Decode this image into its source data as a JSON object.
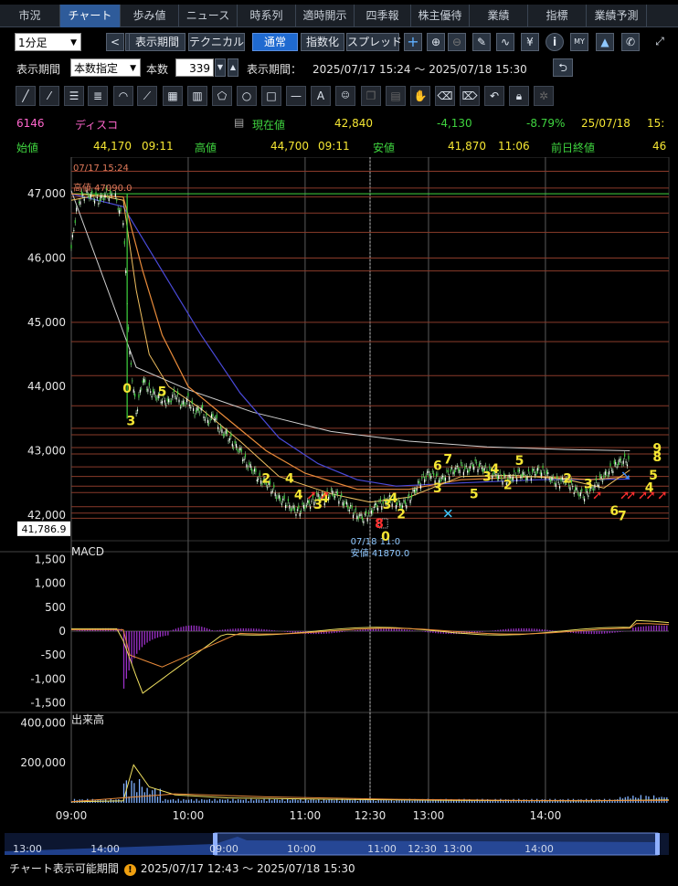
{
  "tabs": [
    "市況",
    "チャート",
    "歩み値",
    "ニュース",
    "時系列",
    "適時開示",
    "四季報",
    "株主優待",
    "業績",
    "指標",
    "業績予測"
  ],
  "active_tab": "チャート",
  "toolbar": {
    "interval": "1分足",
    "prev": "<",
    "next": ">",
    "period_btn": "表示期間",
    "technical_btn": "テクニカル",
    "normal_btn": "通常",
    "index_btn": "指数化",
    "spread_btn": "スプレッド",
    "plus": "+",
    "zoom_in": "⊕",
    "zoom_out": "⊖",
    "draw": "✎",
    "wave": "∿",
    "yen": "¥",
    "info": "i",
    "my": "MY",
    "mountain": "▲",
    "wrench": "✆",
    "expand": "⤢"
  },
  "period": {
    "label": "表示期間",
    "mode": "本数指定",
    "count_label": "本数",
    "count": "339",
    "range_label": "表示期間：",
    "range": "2025/07/17 15:24 ～ 2025/07/18 15:30",
    "reset": "⮌"
  },
  "quote": {
    "code": "6146",
    "name": "ディスコ",
    "current_label": "現在値",
    "current": "42,840",
    "change": "-4,130",
    "change_pct": "-8.79%",
    "date": "25/07/18",
    "time_cut": "15:",
    "open_label": "始値",
    "open": "44,170",
    "open_time": "09:11",
    "high_label": "高値",
    "high": "44,700",
    "high_time": "09:11",
    "low_label": "安値",
    "low": "41,870",
    "low_time": "11:06",
    "prev_label": "前日終値",
    "prev": "46"
  },
  "colors": {
    "bg": "#000000",
    "green": "#3fd43f",
    "yellow": "#f5e633",
    "red": "#ff3030",
    "pink": "#ff66cc",
    "hline": "#8a3b2a",
    "grid": "#5a5a5a"
  },
  "chart_data": {
    "type": "line",
    "price": {
      "yticks": [
        "47,000",
        "46,000",
        "45,000",
        "44,000",
        "43,000",
        "42,000"
      ],
      "ylim": [
        41600,
        47500
      ],
      "last_label": "41,786.9",
      "high_note_date": "07/17 15:24",
      "high_note_text": "高値 47090.0",
      "low_note_date": "07/18 11:0",
      "low_note_text": "安値 41870.0",
      "close": [
        [
          0,
          46150
        ],
        [
          6,
          46900
        ],
        [
          12,
          47000
        ],
        [
          17,
          46950
        ],
        [
          22,
          46900
        ],
        [
          27,
          47000
        ],
        [
          34,
          46950
        ],
        [
          40,
          46600
        ],
        [
          45,
          44500
        ],
        [
          50,
          43600
        ],
        [
          55,
          44100
        ],
        [
          60,
          43950
        ],
        [
          65,
          43850
        ],
        [
          70,
          43800
        ],
        [
          75,
          43750
        ],
        [
          80,
          43900
        ],
        [
          85,
          43700
        ],
        [
          90,
          43800
        ],
        [
          95,
          43600
        ],
        [
          100,
          43650
        ],
        [
          105,
          43450
        ],
        [
          110,
          43550
        ],
        [
          115,
          43300
        ],
        [
          120,
          43250
        ],
        [
          125,
          43100
        ],
        [
          130,
          43000
        ],
        [
          135,
          42800
        ],
        [
          140,
          42700
        ],
        [
          145,
          42550
        ],
        [
          150,
          42500
        ],
        [
          155,
          42400
        ],
        [
          160,
          42250
        ],
        [
          165,
          42200
        ],
        [
          170,
          42100
        ],
        [
          175,
          42050
        ],
        [
          180,
          42150
        ],
        [
          185,
          42200
        ],
        [
          190,
          42300
        ],
        [
          195,
          42250
        ],
        [
          200,
          42350
        ],
        [
          205,
          42300
        ],
        [
          210,
          42200
        ],
        [
          215,
          42100
        ],
        [
          220,
          42000
        ],
        [
          225,
          41950
        ],
        [
          230,
          42050
        ],
        [
          235,
          42150
        ],
        [
          240,
          42200
        ],
        [
          245,
          42250
        ],
        [
          250,
          42200
        ],
        [
          255,
          42150
        ],
        [
          260,
          42250
        ],
        [
          265,
          42400
        ],
        [
          270,
          42550
        ],
        [
          275,
          42650
        ],
        [
          280,
          42600
        ],
        [
          285,
          42550
        ],
        [
          290,
          42650
        ],
        [
          295,
          42700
        ],
        [
          300,
          42750
        ],
        [
          305,
          42700
        ],
        [
          310,
          42800
        ],
        [
          315,
          42750
        ],
        [
          320,
          42700
        ],
        [
          325,
          42650
        ],
        [
          330,
          42600
        ],
        [
          335,
          42550
        ],
        [
          340,
          42600
        ],
        [
          345,
          42650
        ],
        [
          350,
          42600
        ],
        [
          355,
          42650
        ],
        [
          360,
          42700
        ],
        [
          365,
          42650
        ],
        [
          370,
          42550
        ],
        [
          375,
          42500
        ],
        [
          380,
          42550
        ],
        [
          385,
          42450
        ],
        [
          390,
          42350
        ],
        [
          395,
          42300
        ],
        [
          400,
          42400
        ],
        [
          405,
          42500
        ],
        [
          410,
          42600
        ],
        [
          415,
          42700
        ],
        [
          420,
          42800
        ],
        [
          425,
          42850
        ],
        [
          430,
          42840
        ]
      ],
      "ma_short": [
        [
          0,
          46900
        ],
        [
          20,
          46980
        ],
        [
          40,
          46900
        ],
        [
          50,
          45500
        ],
        [
          60,
          44500
        ],
        [
          75,
          44000
        ],
        [
          100,
          43650
        ],
        [
          130,
          43150
        ],
        [
          160,
          42600
        ],
        [
          200,
          42330
        ],
        [
          230,
          42200
        ],
        [
          260,
          42280
        ],
        [
          300,
          42600
        ],
        [
          340,
          42620
        ],
        [
          380,
          42560
        ],
        [
          410,
          42420
        ],
        [
          430,
          42700
        ]
      ],
      "ma_mid": [
        [
          0,
          47000
        ],
        [
          40,
          46950
        ],
        [
          55,
          45800
        ],
        [
          70,
          44800
        ],
        [
          90,
          44000
        ],
        [
          120,
          43500
        ],
        [
          150,
          43000
        ],
        [
          180,
          42650
        ],
        [
          220,
          42400
        ],
        [
          260,
          42400
        ],
        [
          300,
          42550
        ],
        [
          360,
          42600
        ],
        [
          400,
          42550
        ],
        [
          430,
          42600
        ]
      ],
      "ma_long": [
        [
          0,
          47000
        ],
        [
          40,
          46800
        ],
        [
          70,
          45800
        ],
        [
          100,
          44800
        ],
        [
          130,
          43900
        ],
        [
          160,
          43200
        ],
        [
          190,
          42800
        ],
        [
          220,
          42550
        ],
        [
          250,
          42450
        ],
        [
          300,
          42500
        ],
        [
          360,
          42550
        ],
        [
          430,
          42560
        ]
      ],
      "ma_vlong": [
        [
          0,
          47050
        ],
        [
          50,
          44300
        ],
        [
          90,
          43950
        ],
        [
          140,
          43600
        ],
        [
          200,
          43300
        ],
        [
          260,
          43150
        ],
        [
          320,
          43060
        ],
        [
          380,
          43020
        ],
        [
          430,
          43000
        ]
      ],
      "hlines": [
        47350,
        47090,
        46950,
        46700,
        46400,
        46000,
        45800,
        45000,
        44700,
        44170,
        43700,
        43350,
        43250,
        43050,
        42950,
        42750,
        42600,
        42450,
        42350,
        42130,
        42030,
        41950
      ],
      "signals": [
        {
          "t": "0",
          "i": 43,
          "p": 43900
        },
        {
          "t": "3",
          "i": 46,
          "p": 43400
        },
        {
          "t": "5",
          "i": 70,
          "p": 43850
        },
        {
          "t": "2",
          "i": 150,
          "p": 42500
        },
        {
          "t": "4",
          "i": 168,
          "p": 42500
        },
        {
          "t": "4",
          "i": 175,
          "p": 42250
        },
        {
          "t": "3",
          "i": 190,
          "p": 42100
        },
        {
          "t": "4",
          "i": 195,
          "p": 42200
        },
        {
          "t": "3",
          "i": 243,
          "p": 42100
        },
        {
          "t": "4",
          "i": 248,
          "p": 42200
        },
        {
          "t": "2",
          "i": 254,
          "p": 41950
        },
        {
          "t": "8",
          "i": 237,
          "p": 41800
        },
        {
          "t": "0",
          "i": 242,
          "p": 41600
        },
        {
          "t": "6",
          "i": 282,
          "p": 42700
        },
        {
          "t": "7",
          "i": 290,
          "p": 42800
        },
        {
          "t": "3",
          "i": 282,
          "p": 42350
        },
        {
          "t": "5",
          "i": 310,
          "p": 42260
        },
        {
          "t": "3",
          "i": 320,
          "p": 42530
        },
        {
          "t": "4",
          "i": 326,
          "p": 42650
        },
        {
          "t": "2",
          "i": 336,
          "p": 42400
        },
        {
          "t": "5",
          "i": 345,
          "p": 42780
        },
        {
          "t": "2",
          "i": 382,
          "p": 42500
        },
        {
          "t": "3",
          "i": 398,
          "p": 42420
        },
        {
          "t": "6",
          "i": 418,
          "p": 42000
        },
        {
          "t": "7",
          "i": 424,
          "p": 41920
        },
        {
          "t": "4",
          "i": 445,
          "p": 42360
        },
        {
          "t": "5",
          "i": 448,
          "p": 42550
        },
        {
          "t": "8",
          "i": 451,
          "p": 42840
        },
        {
          "t": "9",
          "i": 451,
          "p": 42970
        }
      ],
      "arrows_red": [
        185,
        195,
        405,
        426,
        431,
        440,
        446,
        455
      ],
      "arrows_blue": [
        448
      ],
      "cross": [
        290
      ],
      "xticks": [
        {
          "label": "09:00",
          "i": 0
        },
        {
          "label": "10:00",
          "i": 90
        },
        {
          "label": "11:00",
          "i": 180
        },
        {
          "label": "12:30",
          "i": 230
        },
        {
          "label": "13:00",
          "i": 275
        },
        {
          "label": "14:00",
          "i": 365
        }
      ]
    },
    "macd": {
      "label": "MACD",
      "yticks": [
        "1,500",
        "1,000",
        "500",
        "0",
        "-500",
        "-1,000",
        "-1,500"
      ],
      "ylim": [
        -1550,
        1550
      ]
    },
    "volume": {
      "label": "出来高",
      "yticks": [
        "400,000",
        "200,000"
      ],
      "ylim": [
        0,
        420000
      ]
    }
  },
  "navigator": {
    "ticks": [
      "13:00",
      "14:00",
      "09:00",
      "10:00",
      "11:00",
      "12:30",
      "13:00",
      "14:00"
    ]
  },
  "status": {
    "label": "チャート表示可能期間",
    "range": "2025/07/17 12:43 ～ 2025/07/18 15:30"
  }
}
